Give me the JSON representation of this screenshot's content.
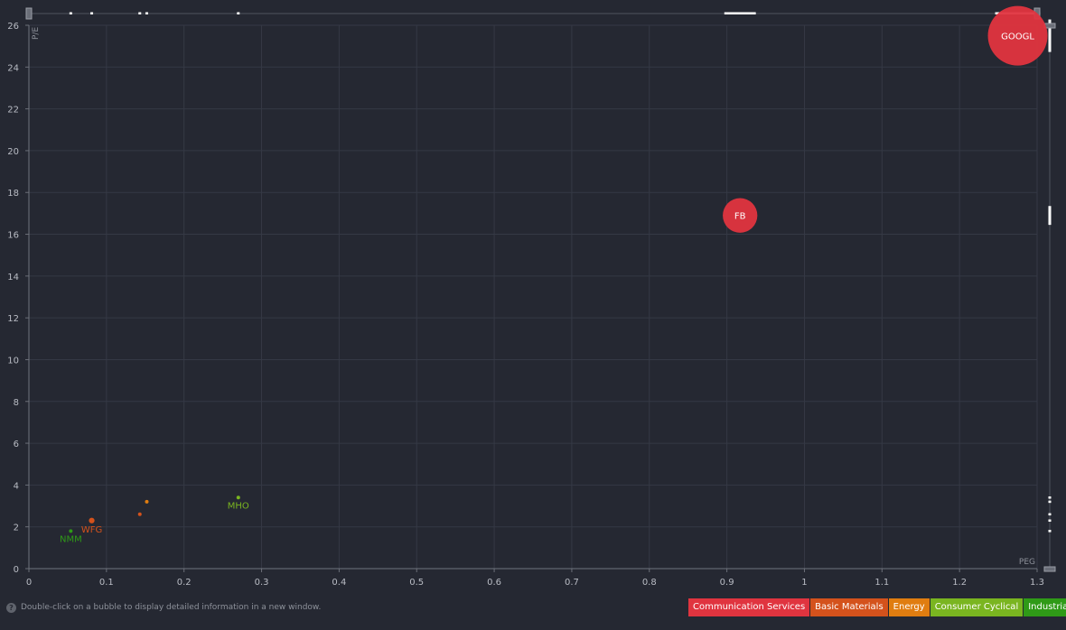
{
  "chart_data": {
    "type": "scatter",
    "title": "",
    "xlabel": "PEG",
    "ylabel": "P/E",
    "xlim": [
      0,
      1.3
    ],
    "ylim": [
      0,
      26
    ],
    "xticks": [
      0,
      0.1,
      0.2,
      0.3,
      0.4,
      0.5,
      0.6,
      0.7,
      0.8,
      0.9,
      1,
      1.1,
      1.2,
      1.3
    ],
    "xtick_labels": [
      "0",
      "0.1",
      "0.2",
      "0.3",
      "0.4",
      "0.5",
      "0.6",
      "0.7",
      "0.8",
      "0.9",
      "1",
      "1.1",
      "1.2",
      "1.3"
    ],
    "yticks": [
      0,
      2,
      4,
      6,
      8,
      10,
      12,
      14,
      16,
      18,
      20,
      22,
      24,
      26
    ],
    "ytick_labels": [
      "0",
      "2",
      "4",
      "6",
      "8",
      "10",
      "12",
      "14",
      "16",
      "18",
      "20",
      "22",
      "24",
      "26"
    ],
    "grid": true,
    "legend_position": "bottom-right",
    "categories": [
      {
        "name": "Communication Services",
        "color": "#e0343f"
      },
      {
        "name": "Basic Materials",
        "color": "#d4521c"
      },
      {
        "name": "Energy",
        "color": "#e07d10"
      },
      {
        "name": "Consumer Cyclical",
        "color": "#7ab520"
      },
      {
        "name": "Industrials",
        "color": "#2f9a17"
      }
    ],
    "points": [
      {
        "label": "GOOGL",
        "x": 1.275,
        "y": 25.5,
        "sector": "Communication Services",
        "size": 1.0
      },
      {
        "label": "FB",
        "x": 0.917,
        "y": 16.9,
        "sector": "Communication Services",
        "size": 0.58
      },
      {
        "label": "WFG",
        "x": 0.081,
        "y": 2.3,
        "sector": "Basic Materials",
        "size": 0.12
      },
      {
        "label": "",
        "x": 0.143,
        "y": 2.6,
        "sector": "Basic Materials",
        "size": 0.07
      },
      {
        "label": "",
        "x": 0.152,
        "y": 3.2,
        "sector": "Energy",
        "size": 0.07
      },
      {
        "label": "MHO",
        "x": 0.27,
        "y": 3.4,
        "sector": "Consumer Cyclical",
        "size": 0.05
      },
      {
        "label": "NMM",
        "x": 0.054,
        "y": 1.8,
        "sector": "Industrials",
        "size": 0.05
      }
    ]
  },
  "footer": {
    "hint": "Double-click on a bubble to display detailed information in a new window."
  }
}
